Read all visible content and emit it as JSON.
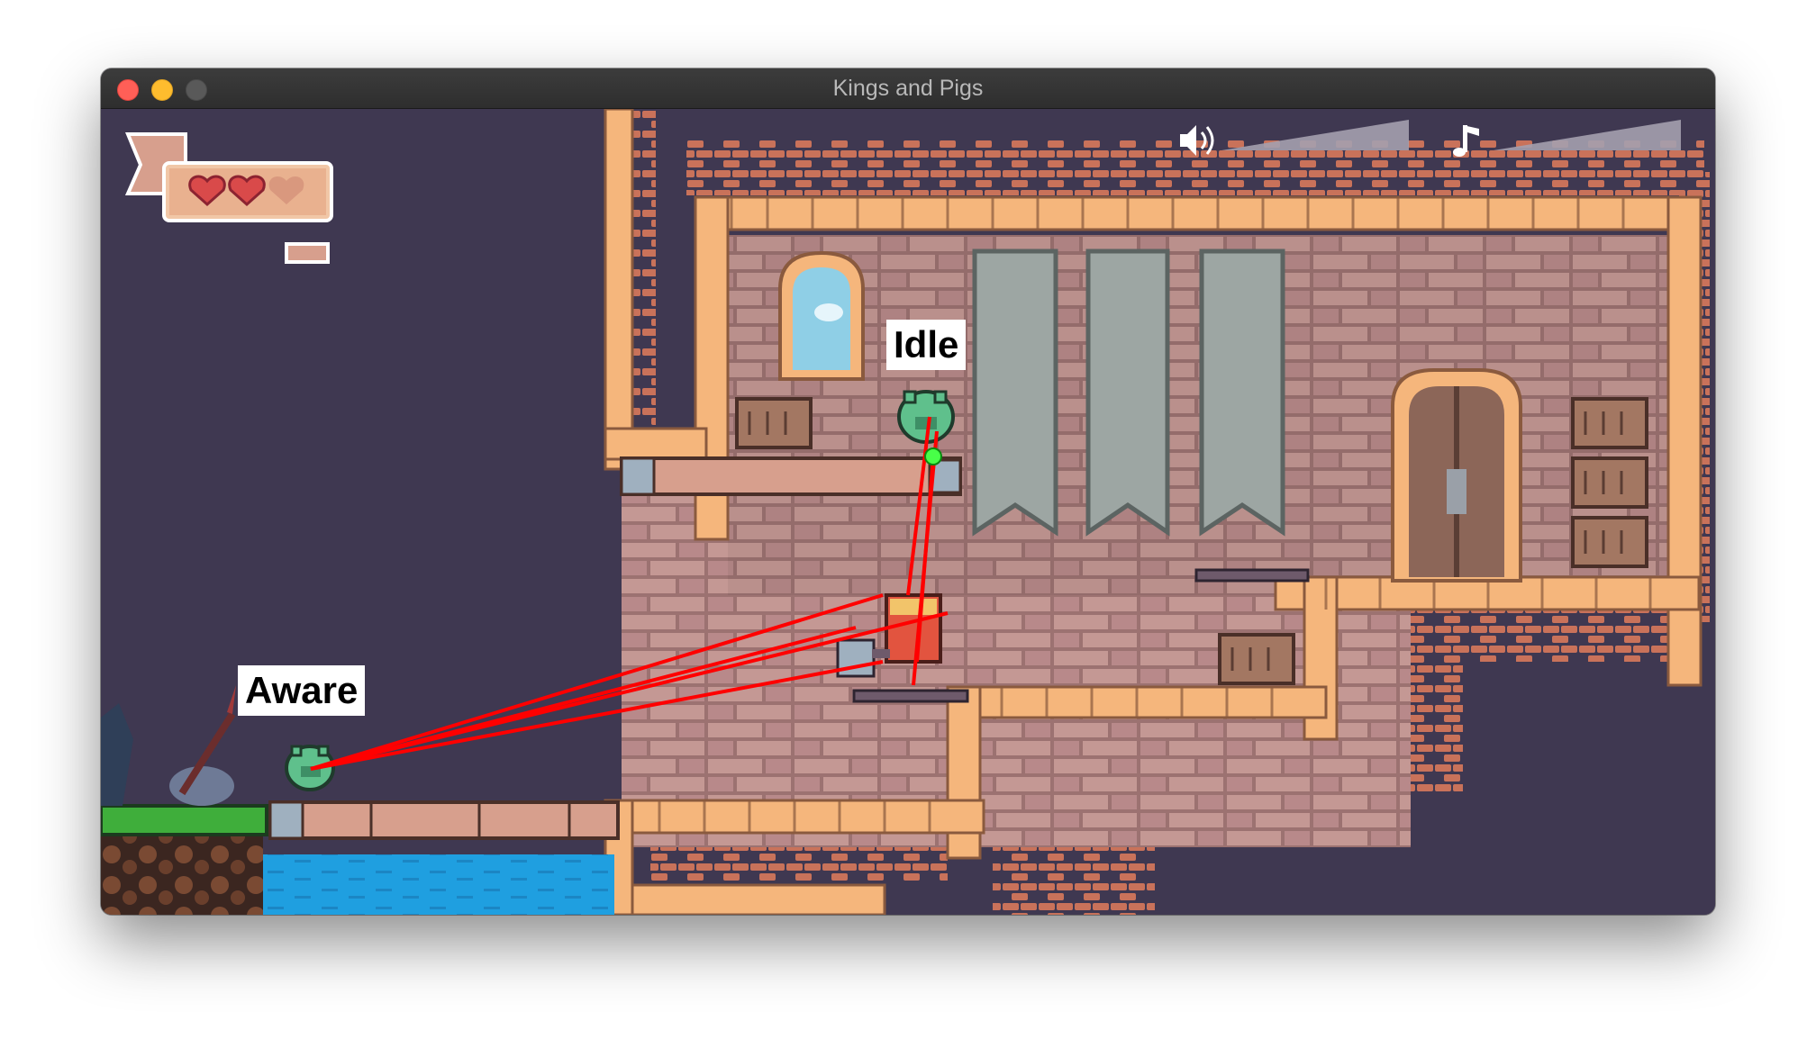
{
  "window": {
    "title": "Kings and Pigs"
  },
  "hud": {
    "health": {
      "hearts_total": 3,
      "hearts_full": 2
    },
    "icons": [
      "speaker-icon",
      "music-note-icon"
    ]
  },
  "enemies": [
    {
      "state_label": "Idle"
    },
    {
      "state_label": "Aware"
    }
  ],
  "colors": {
    "background": "#3f3851",
    "brick": "#b5837a",
    "orange_frame": "#f5b67c",
    "outer_brick": "#c9725a",
    "water": "#1f9fe0",
    "grass": "#3fae3b",
    "pig": "#5fc08c",
    "king": "#e2543f",
    "raycast": "#ff0000"
  }
}
